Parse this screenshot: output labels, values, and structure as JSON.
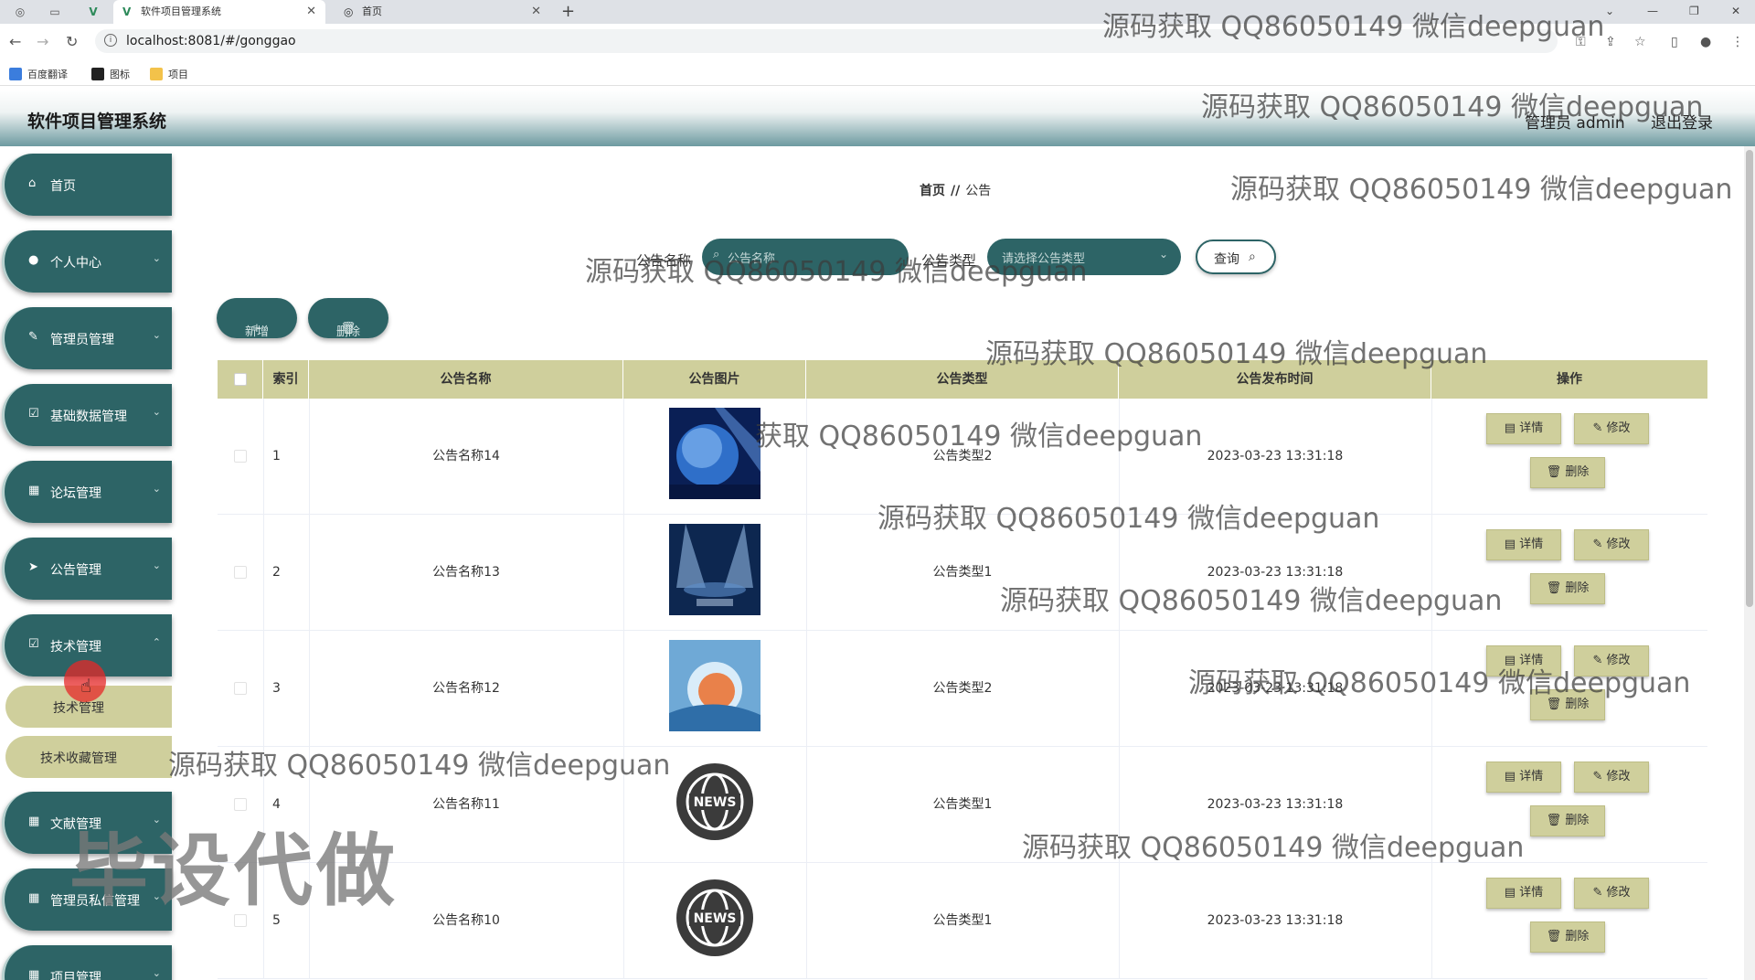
{
  "browser": {
    "tabs": [
      {
        "title": "软件项目管理系统",
        "active": true
      },
      {
        "title": "首页",
        "active": false
      }
    ],
    "url": "localhost:8081/#/gonggao",
    "bookmarks": [
      "百度翻译",
      "图标",
      "项目"
    ]
  },
  "app": {
    "title": "软件项目管理系统",
    "admin_label": "管理员 admin",
    "logout_label": "退出登录"
  },
  "sidebar": {
    "items": [
      {
        "label": "首页",
        "icon": "home-icon"
      },
      {
        "label": "个人中心",
        "icon": "user-icon"
      },
      {
        "label": "管理员管理",
        "icon": "pen-icon"
      },
      {
        "label": "基础数据管理",
        "icon": "check-square-icon"
      },
      {
        "label": "论坛管理",
        "icon": "grid-icon"
      },
      {
        "label": "公告管理",
        "icon": "send-icon"
      },
      {
        "label": "技术管理",
        "icon": "check-square-icon"
      },
      {
        "label": "文献管理",
        "icon": "grid-icon"
      },
      {
        "label": "管理员私信管理",
        "icon": "grid-icon"
      },
      {
        "label": "项目管理",
        "icon": "grid-icon"
      }
    ],
    "submenu": [
      "技术管理",
      "技术收藏管理"
    ]
  },
  "breadcrumb": {
    "home": "首页",
    "separator": "//",
    "current": "公告"
  },
  "search": {
    "name_label": "公告名称",
    "name_placeholder": "公告名称",
    "type_label": "公告类型",
    "type_placeholder": "请选择公告类型",
    "query_label": "查询"
  },
  "actions": {
    "add_label": "新增",
    "delete_label": "删除"
  },
  "table": {
    "columns": [
      "索引",
      "公告名称",
      "公告图片",
      "公告类型",
      "公告发布时间",
      "操作"
    ],
    "rows": [
      {
        "index": "1",
        "name": "公告名称14",
        "type": "公告类型2",
        "time": "2023-03-23 13:31:18",
        "image": "globe-image"
      },
      {
        "index": "2",
        "name": "公告名称13",
        "type": "公告类型1",
        "time": "2023-03-23 13:31:18",
        "image": "stage-image"
      },
      {
        "index": "3",
        "name": "公告名称12",
        "type": "公告类型2",
        "time": "2023-03-23 13:31:18",
        "image": "news-blue-image"
      },
      {
        "index": "4",
        "name": "公告名称11",
        "type": "公告类型1",
        "time": "2023-03-23 13:31:18",
        "image": "news-globe-icon"
      },
      {
        "index": "5",
        "name": "公告名称10",
        "type": "公告类型1",
        "time": "2023-03-23 13:31:18",
        "image": "news-globe-icon"
      }
    ],
    "op_detail": "详情",
    "op_edit": "修改",
    "op_delete": "删除"
  },
  "watermarks": {
    "text": "源码获取 QQ86050149 微信deepguan",
    "partial": "获取 QQ86050149 微信deepguan",
    "big": "毕设代做"
  },
  "colors": {
    "primary": "#2d6466",
    "accent": "#cfcf9c"
  }
}
